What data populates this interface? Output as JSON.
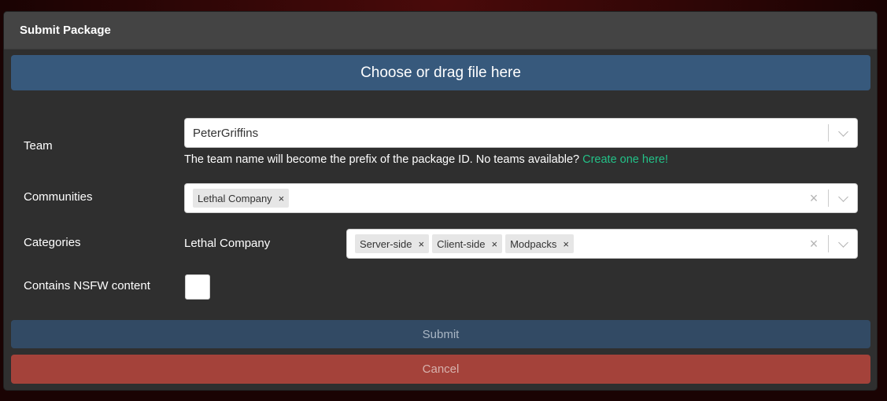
{
  "modal": {
    "title": "Submit Package",
    "dropzone_label": "Choose or drag file here"
  },
  "team": {
    "label": "Team",
    "value": "PeterGriffins",
    "hint": "The team name will become the prefix of the package ID. No teams available?",
    "hint_link": "Create one here!"
  },
  "communities": {
    "label": "Communities",
    "chips": [
      "Lethal Company"
    ]
  },
  "categories": {
    "label": "Categories",
    "community": "Lethal Company",
    "chips": [
      "Server-side",
      "Client-side",
      "Modpacks"
    ]
  },
  "nsfw": {
    "label": "Contains NSFW content",
    "checked": false
  },
  "buttons": {
    "submit": "Submit",
    "cancel": "Cancel"
  },
  "icons": {
    "remove": "×",
    "clear": "×"
  },
  "colors": {
    "dropzone": "#37597c",
    "submit": "#324a64",
    "cancel": "#a4423a",
    "link": "#23c087"
  }
}
